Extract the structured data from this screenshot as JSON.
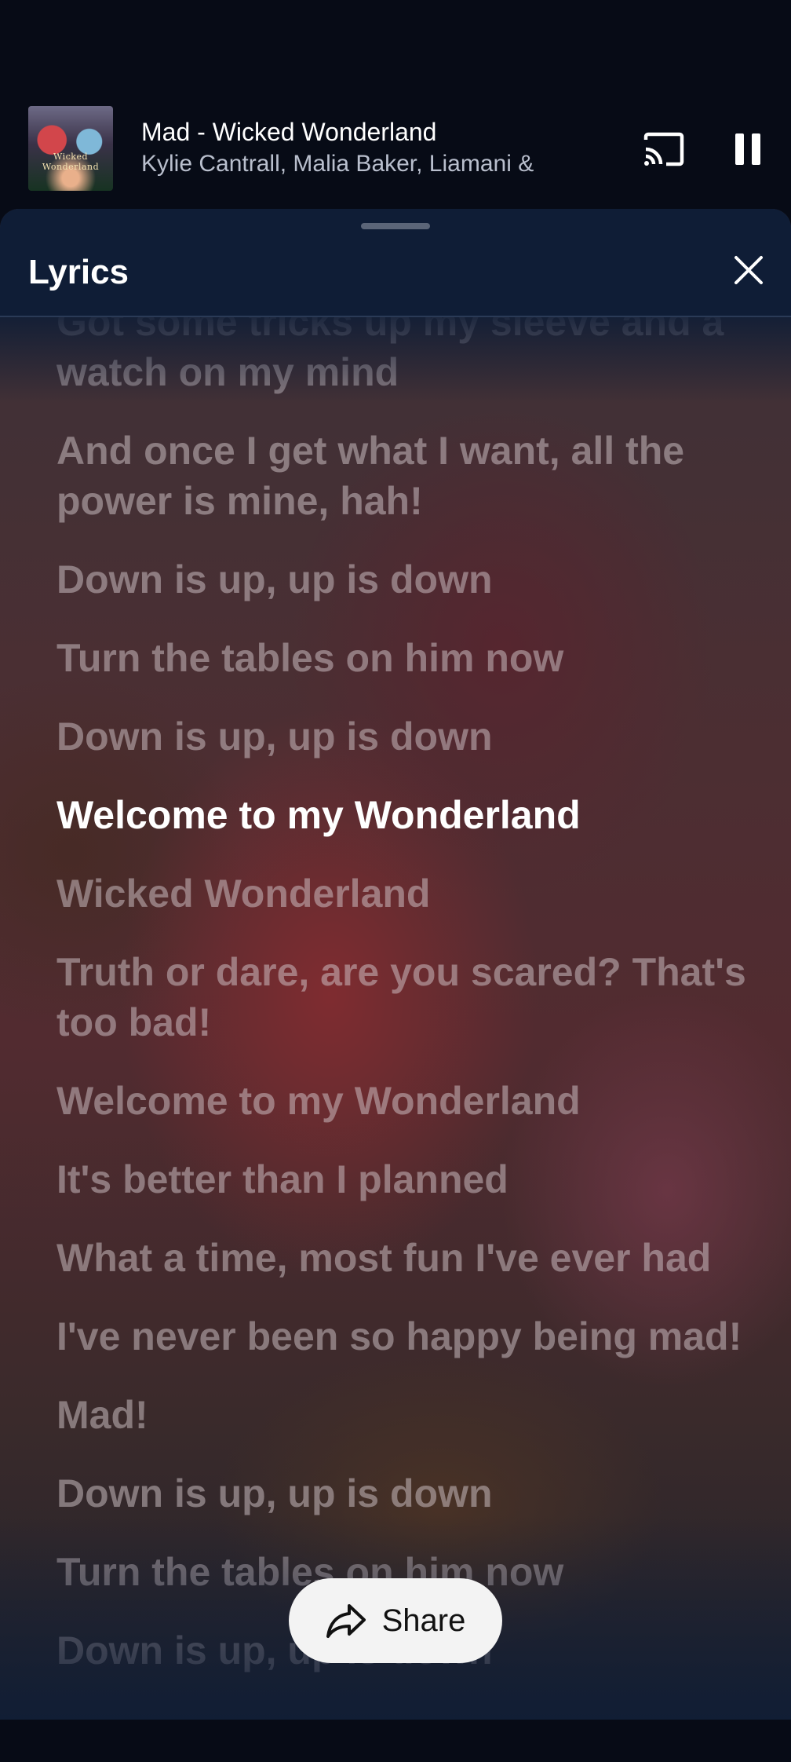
{
  "mini_player": {
    "title": "Mad - Wicked Wonderland",
    "artists": "Kylie Cantrall, Malia Baker, Liamani &",
    "album_art_text": "Wicked Wonderland",
    "cast_icon": "cast-icon",
    "pause_icon": "pause-icon"
  },
  "lyrics_sheet": {
    "title": "Lyrics",
    "close_icon": "close-icon",
    "lines": [
      "Got some tricks up my sleeve and a watch on my mind",
      "And once I get what I want, all the power is mine, hah!",
      "Down is up, up is down",
      "Turn the tables on him now",
      "Down is up, up is down",
      "Welcome to my Wonderland",
      "Wicked Wonderland",
      "Truth or dare, are you scared? That's too bad!",
      "Welcome to my Wonderland",
      "It's better than I planned",
      "What a time, most fun I've ever had",
      "I've never been so happy being mad!",
      "Mad!",
      "Down is up, up is down",
      "Turn the tables on him now",
      "Down is up, up is down"
    ],
    "active_line_index": 5
  },
  "share": {
    "label": "Share",
    "icon": "share-icon"
  },
  "colors": {
    "header_bg": "#0f1d36",
    "active_lyric": "#ffffff",
    "inactive_lyric": "rgba(212,200,204,0.5)",
    "share_bg": "#f3f3f3"
  }
}
